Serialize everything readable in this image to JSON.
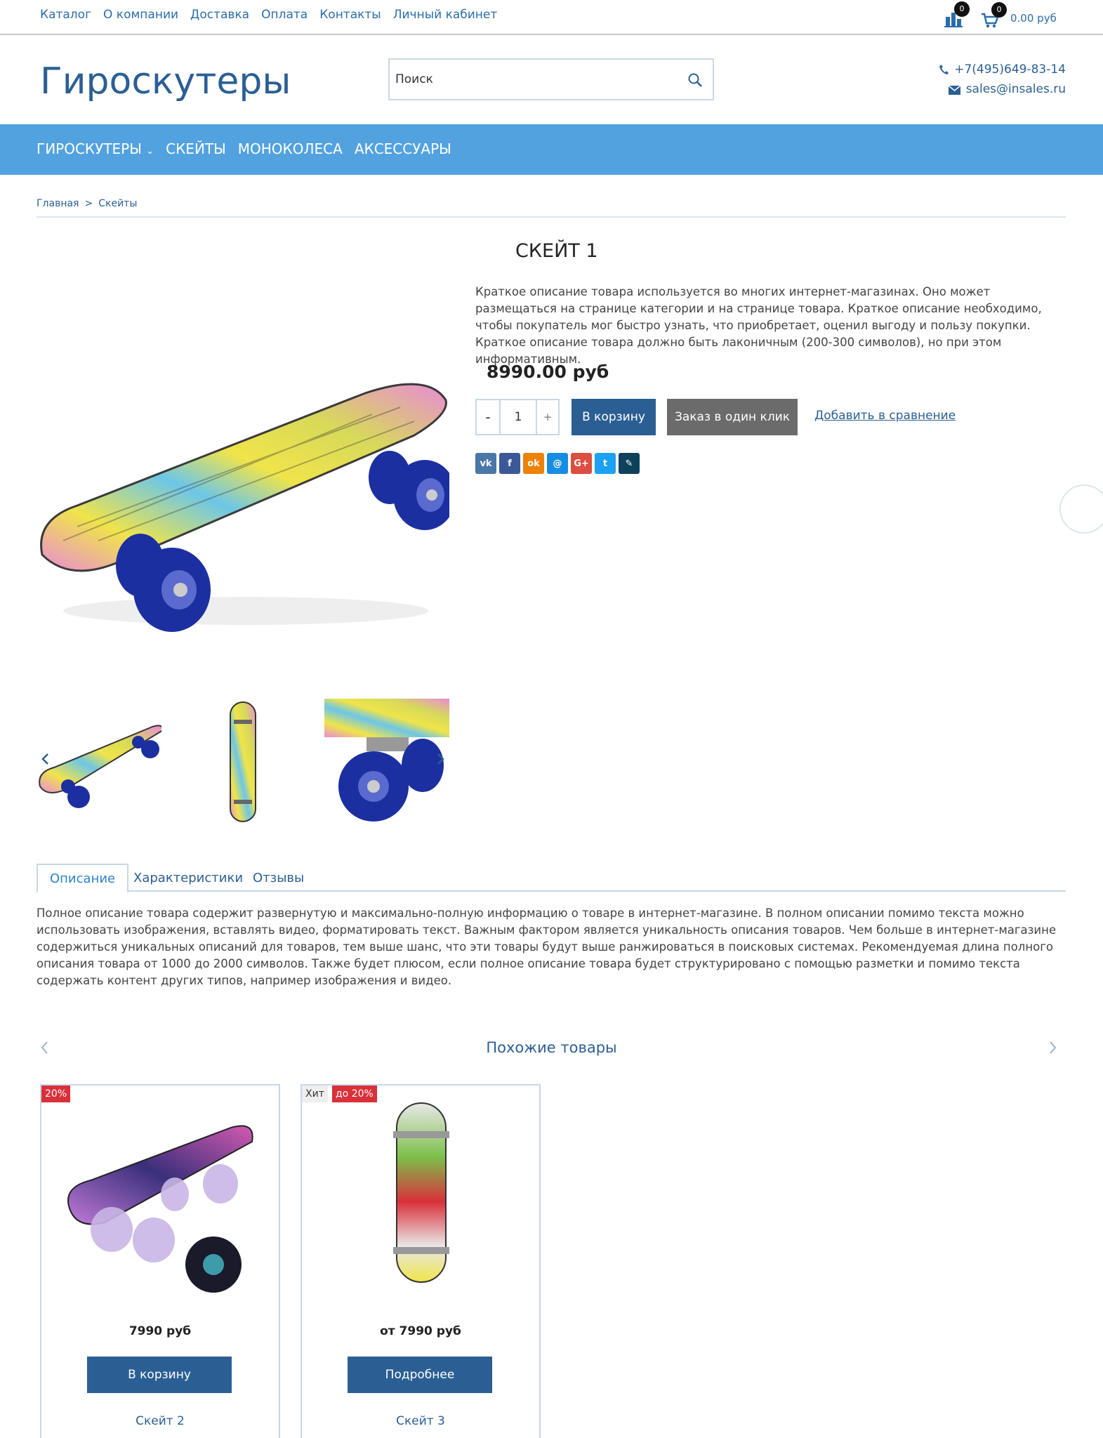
{
  "topnav": [
    "Каталог",
    "О компании",
    "Доставка",
    "Оплата",
    "Контакты",
    "Личный кабинет"
  ],
  "header": {
    "compare_count": "0",
    "cart_count": "0",
    "cart_sum": "0.00 руб",
    "logo": "Гироскутеры",
    "search_placeholder": "Поиск",
    "phone": "+7(495)649-83-14",
    "email": "sales@insales.ru"
  },
  "menu": [
    "Гироскутеры",
    "Скейты",
    "Моноколеса",
    "Аксессуары"
  ],
  "breadcrumb": {
    "home": "Главная",
    "sep": ">",
    "current": "Скейты"
  },
  "product": {
    "title": "СКЕЙТ 1",
    "short_desc": "Краткое описание товара используется во многих интернет-магазинах. Оно может размещаться на странице категории и на странице товара. Краткое описание необходимо, чтобы покупатель мог быстро узнать, что приобретает, оценил выгоду и пользу покупки. Краткое описание товара должно быть лаконичным (200-300 символов), но при этом информативным.",
    "price": "8990.00 руб",
    "qty_minus": "-",
    "qty": "1",
    "qty_plus": "+",
    "add_to_cart": "В корзину",
    "one_click": "Заказ в один клик",
    "compare": "Добавить в сравнение"
  },
  "social": [
    {
      "icon": "vk-icon",
      "label": "vk",
      "color": "#4a76a8"
    },
    {
      "icon": "facebook-icon",
      "label": "f",
      "color": "#3b5998"
    },
    {
      "icon": "odnoklassniki-icon",
      "label": "ok",
      "color": "#ee8208"
    },
    {
      "icon": "moimir-icon",
      "label": "@",
      "color": "#168de2"
    },
    {
      "icon": "googleplus-icon",
      "label": "G+",
      "color": "#dc4e41"
    },
    {
      "icon": "twitter-icon",
      "label": "t",
      "color": "#1da1f2"
    },
    {
      "icon": "livejournal-icon",
      "label": "✎",
      "color": "#0d425a"
    }
  ],
  "tabs": [
    "Описание",
    "Характеристики",
    "Отзывы"
  ],
  "full_desc": "Полное описание товара содержит развернутую и максимально-полную информацию о товаре в интернет-магазине. В полном описании помимо текста можно использовать изображения, вставлять видео, форматировать текст. Важным фактором является уникальность описания товаров. Чем больше в интернет-магазине содержиться уникальных описаний для товаров, тем выше шанс, что эти товары будут выше ранжироваться в поисковых системах. Рекомендуемая длина полного описания товара от 1000 до 2000 символов. Также будет плюсом, если полное описание товара будет структурировано с помощью разметки и помимо текста содержать контент других типов, например изображения и видео.",
  "similar": {
    "title": "Похожие товары",
    "cards": [
      {
        "labels": [
          {
            "text": "20%",
            "style": "red"
          }
        ],
        "price": "7990 руб",
        "button": "В корзину",
        "name": "Скейт 2"
      },
      {
        "labels": [
          {
            "text": "Хит",
            "style": "gray"
          },
          {
            "text": "до 20%",
            "style": "red"
          }
        ],
        "price": "от 7990 руб",
        "button": "Подробнее",
        "name": "Скейт 3"
      }
    ]
  },
  "colors": {
    "brand": "#2b5f94",
    "menu_bg": "#52a2e0",
    "sale": "#d9303a",
    "oneclick": "#6b6b6b"
  }
}
